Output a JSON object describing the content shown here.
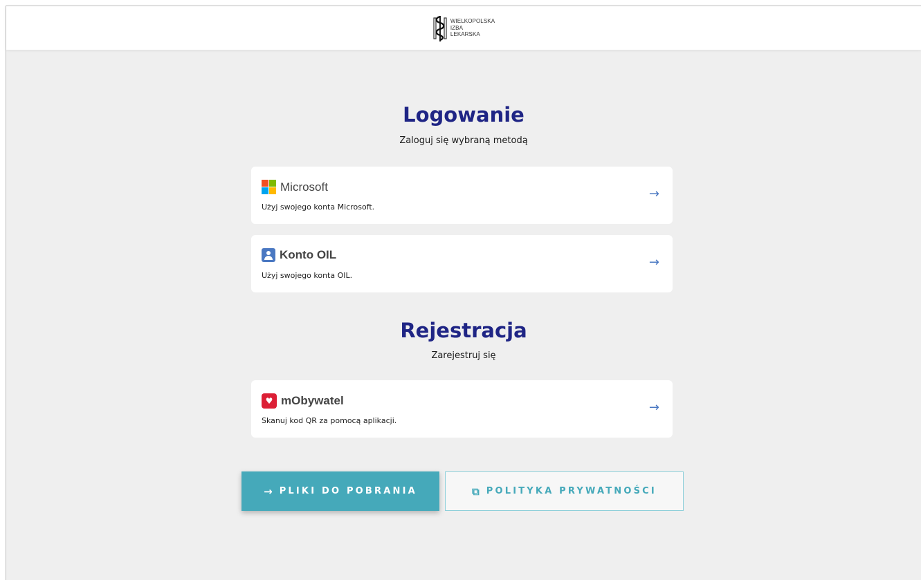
{
  "header": {
    "logo_lines": [
      "WIELKOPOLSKA",
      "IZBA",
      "LEKARSKA"
    ]
  },
  "login": {
    "title": "Logowanie",
    "subtitle": "Zaloguj się wybraną metodą",
    "options": [
      {
        "name": "Microsoft",
        "description": "Użyj swojego konta Microsoft.",
        "icon": "microsoft-logo-icon"
      },
      {
        "name": "Konto OIL",
        "description": "Użyj swojego konta OIL.",
        "icon": "user-badge-icon"
      }
    ]
  },
  "register": {
    "title": "Rejestracja",
    "subtitle": "Zarejestruj się",
    "options": [
      {
        "name": "mObywatel",
        "description": "Skanuj kod QR za pomocą aplikacji.",
        "icon": "mobywatel-eagle-icon"
      }
    ]
  },
  "buttons": {
    "downloads": {
      "icon": "→",
      "label": "PLIKI DO POBRANIA"
    },
    "privacy": {
      "icon": "⧉",
      "label": "POLITYKA PRYWATNOŚCI"
    }
  },
  "colors": {
    "title": "#1f2585",
    "accent": "#45a9ba",
    "arrow": "#4a78c2",
    "mobywatel": "#dc1f35"
  }
}
